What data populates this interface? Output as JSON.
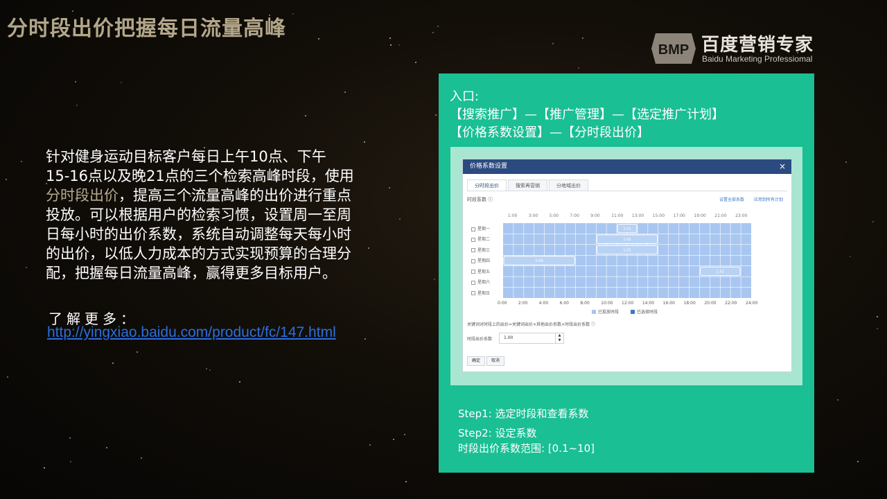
{
  "slide": {
    "title": "分时段出价把握每日流量高峰"
  },
  "brand": {
    "logo_mark": "BMP",
    "name": "百度营销专家",
    "subtitle": "Baidu Marketing Professiomal"
  },
  "body": {
    "text_1": "针对健身运动目标客户每日上午10点、下午",
    "text_2": "15-16点以及晚21点的三个检索高峰时段，使用",
    "highlight": "分时段出价",
    "text_3": "，提高三个流量高峰的出价进行重点",
    "text_4": "投放。可以根据用户的检索习惯，设置周一至周",
    "text_5": "日每小时的出价系数，系统自动调整每天每小时",
    "text_6": "的出价，以低人力成本的方式实现预算的合理分",
    "text_7": "配，把握每日流量高峰，赢得更多目标用户。",
    "learn_more": "了解更多：",
    "link": "http://yingxiao.baidu.com/product/fc/147.html"
  },
  "panel": {
    "entry_1": "入口:",
    "entry_2": "【搜索推广】—【推广管理】—【选定推广计划】",
    "entry_3": "【价格系数设置】—【分时段出价】",
    "step_1": "Step1:  选定时段和查看系数",
    "step_2": "Step2:  设定系数",
    "step_3": "时段出价系数范围:  [0.1~10]",
    "colors": {
      "panel": "#1abf94",
      "grid": "#a8c6f0",
      "grid_line": "#ffffff",
      "header": "#2b4a80"
    }
  },
  "dialog": {
    "title": "价格系数设置",
    "close": "×",
    "tabs": [
      "分时段出价",
      "搜索再营销",
      "分地域出价"
    ],
    "section": "时段系数 ⓘ",
    "links": [
      "设置全部系数",
      "应用到所有计划"
    ],
    "hours_top": [
      "1:00",
      "3:00",
      "5:00",
      "7:00",
      "9:00",
      "11:00",
      "13:00",
      "15:00",
      "17:00",
      "19:00",
      "21:00",
      "23:00"
    ],
    "hours_bottom": [
      "0:00",
      "2:00",
      "4:00",
      "6:00",
      "8:00",
      "10:00",
      "12:00",
      "14:00",
      "16:00",
      "18:00",
      "20:00",
      "22:00",
      "24:00"
    ],
    "days": [
      "星期一",
      "星期二",
      "星期三",
      "星期四",
      "星期五",
      "星期六",
      "星期日"
    ],
    "blocks": [
      {
        "label": "1.01",
        "day": 0,
        "start": 11,
        "end": 13
      },
      {
        "label": "1.02",
        "day": 1,
        "start": 9,
        "end": 15
      },
      {
        "label": "1.01",
        "day": 2,
        "start": 9,
        "end": 15
      },
      {
        "label": "0.89",
        "day": 3,
        "start": 0,
        "end": 7
      },
      {
        "label": "1.01",
        "day": 4,
        "start": 19,
        "end": 23
      }
    ],
    "legend": [
      "已投放时段",
      "已选择时段"
    ],
    "note": "关键词对时段上的出价=关键词出价×其他出价系数×时段出价系数 ⓘ",
    "bid_label": "时段出价系数",
    "bid_value": "1.00",
    "ok": "确定",
    "cancel": "取消"
  }
}
